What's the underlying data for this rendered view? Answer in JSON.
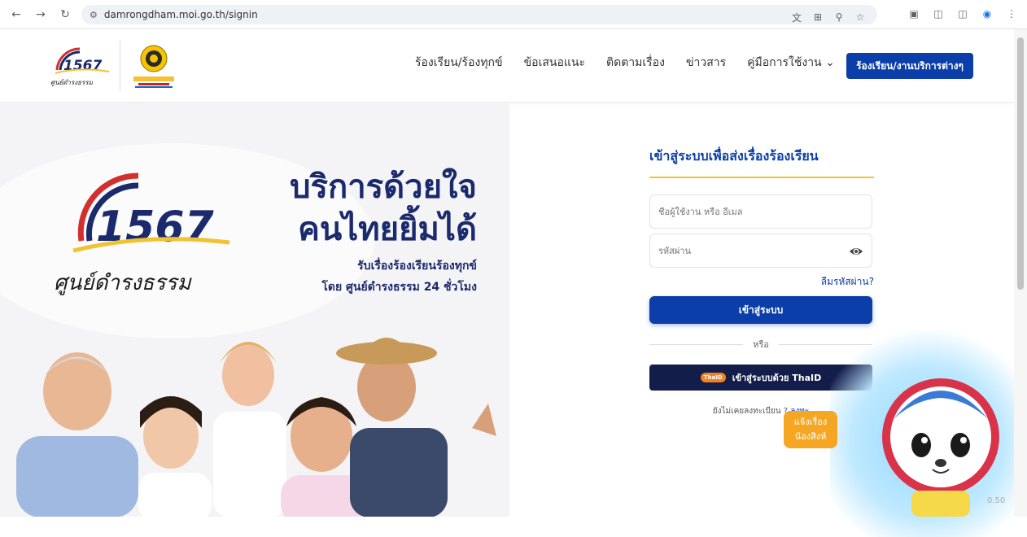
{
  "browser": {
    "url": "damrongdham.moi.go.th/signin",
    "back_icon": "arrow-left-icon",
    "forward_icon": "arrow-right-icon",
    "reload_icon": "reload-icon"
  },
  "header": {
    "nav": [
      {
        "label": "ร้องเรียน/ร้องทุกข์"
      },
      {
        "label": "ข้อเสนอแนะ"
      },
      {
        "label": "ติดตามเรื่อง"
      },
      {
        "label": "ข่าวสาร"
      },
      {
        "label": "คู่มือการใช้งาน ⌄"
      }
    ],
    "cta_label": "ร้องเรียน/งานบริการต่างๆ",
    "logo_number": "1567",
    "logo_script": "ศูนย์ดำรงธรรม"
  },
  "hero": {
    "logo_number": "1567",
    "logo_script": "ศูนย์ดำรงธรรม",
    "title_line1": "บริการด้วยใจ",
    "title_line2": "คนไทยยิ้มได้",
    "sub_line1": "รับเรื่องร้องเรียนร้องทุกข์",
    "sub_line2": "โดย ศูนย์ดำรงธรรม 24 ชั่วโมง"
  },
  "login": {
    "title": "เข้าสู่ระบบเพื่อส่งเรื่องร้องเรียน",
    "username_placeholder": "ชื่อผู้ใช้งาน หรือ อีเมล",
    "password_placeholder": "รหัสผ่าน",
    "forgot": "ลืมรหัสผ่าน?",
    "submit": "เข้าสู่ระบบ",
    "or": "หรือ",
    "thaid_badge": "ThaID",
    "thaid_label": "เข้าสู่ระบบด้วย ThaID",
    "register_text": "ยังไม่เคยลงทะเบียน ?",
    "register_link": "ลงทะ"
  },
  "chat": {
    "line1": "แจ้งเรื่อง",
    "line2": "น้องสิงห์"
  },
  "version": "0.50",
  "colors": {
    "primary": "#0b3ea8",
    "navy": "#131d4a",
    "accent": "#f1c232",
    "chat": "#f5a623"
  }
}
